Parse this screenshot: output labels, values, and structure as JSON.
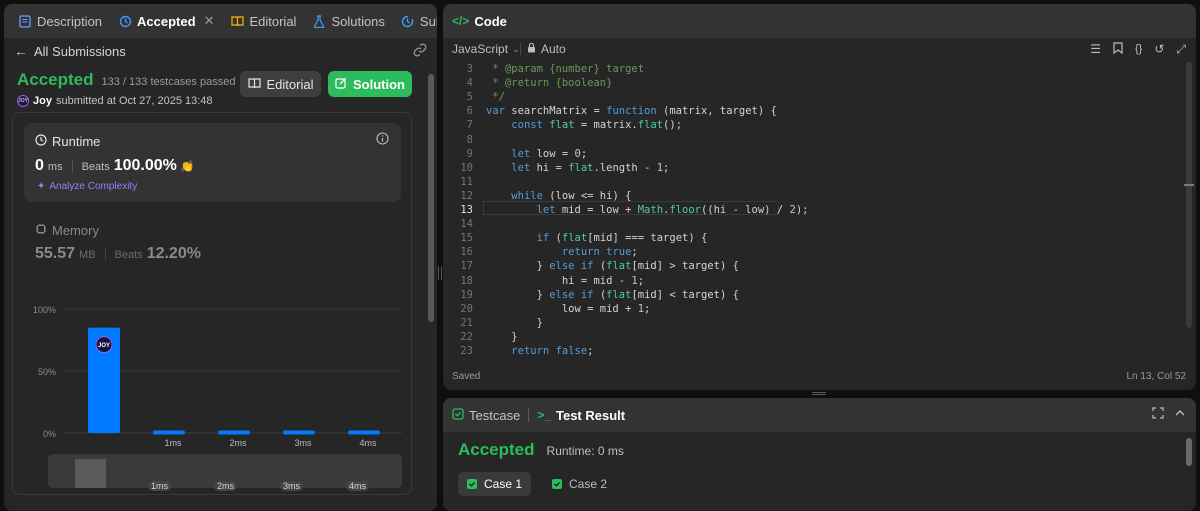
{
  "colors": {
    "accent_green": "#2cbb5d",
    "bar_blue": "#007aff",
    "bg_panel": "#262626"
  },
  "left_tabs": [
    {
      "label": "Description",
      "icon": "description-icon"
    },
    {
      "label": "Accepted",
      "icon": "history-icon"
    },
    {
      "label": "Editorial",
      "icon": "book-icon"
    },
    {
      "label": "Solutions",
      "icon": "flask-icon"
    },
    {
      "label": "Submissions",
      "icon": "history-icon"
    }
  ],
  "subbar": {
    "back_label": "All Submissions"
  },
  "submission": {
    "status": "Accepted",
    "testcases": "133 / 133 testcases passed",
    "user": "Joy",
    "submitted": "submitted at Oct 27, 2025 13:48",
    "avatar_text": "JOY"
  },
  "buttons": {
    "editorial": "Editorial",
    "solution": "Solution"
  },
  "runtime": {
    "title": "Runtime",
    "value": "0",
    "unit": "ms",
    "beats_label": "Beats",
    "beats": "100.00%",
    "analyze": "Analyze Complexity"
  },
  "memory": {
    "title": "Memory",
    "value": "55.57",
    "unit": "MB",
    "beats_label": "Beats",
    "beats": "12.20%"
  },
  "chart_data": {
    "type": "bar",
    "categories": [
      "",
      "1ms",
      "2ms",
      "3ms",
      "4ms"
    ],
    "values": [
      85,
      2,
      2,
      2,
      2
    ],
    "y_ticks": [
      "100%",
      "50%",
      "0%"
    ],
    "ylim": [
      0,
      100
    ],
    "highlight_index": 0,
    "grid": true
  },
  "mini_labels": [
    "1ms",
    "2ms",
    "3ms",
    "4ms"
  ],
  "code_panel": {
    "title": "Code",
    "language": "JavaScript",
    "auto_label": "Auto",
    "status": "Saved",
    "cursor": "Ln 13, Col 52"
  },
  "code_lines": [
    {
      "n": "3",
      "t": " * @param {number} target"
    },
    {
      "n": "4",
      "t": " * @return {boolean}"
    },
    {
      "n": "5",
      "t": " */"
    },
    {
      "n": "6",
      "t": "var searchMatrix = function (matrix, target) {"
    },
    {
      "n": "7",
      "t": "    const flat = matrix.flat();"
    },
    {
      "n": "8",
      "t": ""
    },
    {
      "n": "9",
      "t": "    let low = 0;"
    },
    {
      "n": "10",
      "t": "    let hi = flat.length - 1;"
    },
    {
      "n": "11",
      "t": ""
    },
    {
      "n": "12",
      "t": "    while (low <= hi) {"
    },
    {
      "n": "13",
      "t": "        let mid = low + Math.floor((hi - low) / 2);"
    },
    {
      "n": "14",
      "t": ""
    },
    {
      "n": "15",
      "t": "        if (flat[mid] === target) {"
    },
    {
      "n": "16",
      "t": "            return true;"
    },
    {
      "n": "17",
      "t": "        } else if (flat[mid] > target) {"
    },
    {
      "n": "18",
      "t": "            hi = mid - 1;"
    },
    {
      "n": "19",
      "t": "        } else if (flat[mid] < target) {"
    },
    {
      "n": "20",
      "t": "            low = mid + 1;"
    },
    {
      "n": "21",
      "t": "        }"
    },
    {
      "n": "22",
      "t": "    }"
    },
    {
      "n": "23",
      "t": "    return false;"
    }
  ],
  "result_panel": {
    "tab_testcase": "Testcase",
    "tab_result": "Test Result",
    "status": "Accepted",
    "runtime": "Runtime: 0 ms",
    "cases": [
      "Case 1",
      "Case 2"
    ]
  }
}
